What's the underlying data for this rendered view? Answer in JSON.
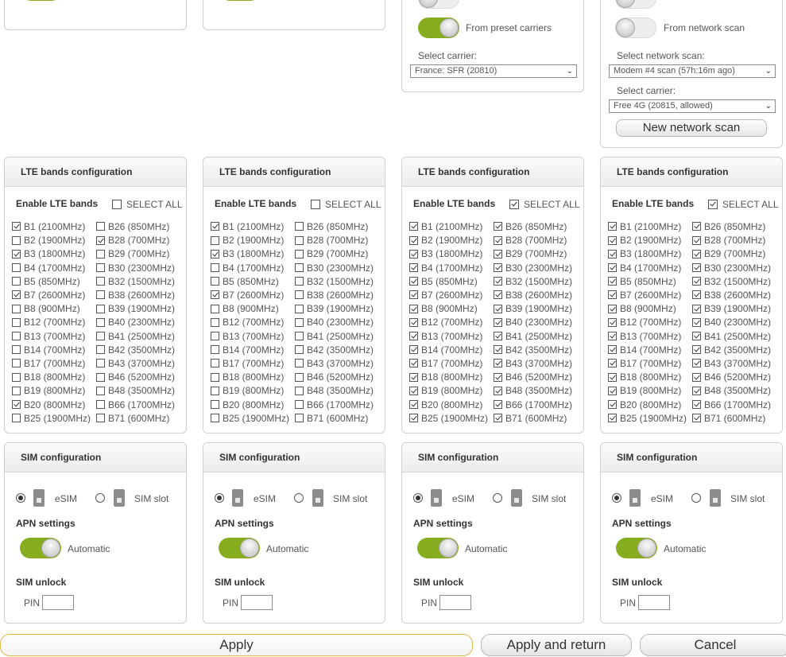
{
  "top": {
    "col3": {
      "from_label": "From preset carriers",
      "select_carrier_label": "Select carrier:",
      "carrier_value": "France: SFR (20810)"
    },
    "col4": {
      "from_label": "From network scan",
      "select_scan_label": "Select network scan:",
      "scan_value": "Modem #4 scan (57h:16m ago)",
      "select_carrier_label": "Select carrier:",
      "carrier_value": "Free 4G (20815, allowed)",
      "new_scan_button": "New network scan"
    }
  },
  "lte": {
    "title": "LTE bands configuration",
    "enable_label": "Enable LTE bands",
    "select_all_label": "SELECT ALL",
    "left_bands": [
      "B1 (2100MHz)",
      "B2 (1900MHz)",
      "B3 (1800MHz)",
      "B4 (1700MHz)",
      "B5 (850MHz)",
      "B7 (2600MHz)",
      "B8 (900MHz)",
      "B12 (700MHz)",
      "B13 (700MHz)",
      "B14 (700MHz)",
      "B17 (700MHz)",
      "B18 (800MHz)",
      "B19 (800MHz)",
      "B20 (800MHz)",
      "B25 (1900MHz)"
    ],
    "right_bands": [
      "B26 (850MHz)",
      "B28 (700MHz)",
      "B29 (700MHz)",
      "B30 (2300MHz)",
      "B32 (1500MHz)",
      "B38 (2600MHz)",
      "B39 (1900MHz)",
      "B40 (2300MHz)",
      "B41 (2500MHz)",
      "B42 (3500MHz)",
      "B43 (3700MHz)",
      "B46 (5200MHz)",
      "B48 (3500MHz)",
      "B66 (1700MHz)",
      "B71 (600MHz)"
    ],
    "modems": [
      {
        "select_all": false,
        "left": [
          true,
          false,
          true,
          false,
          false,
          true,
          false,
          false,
          false,
          false,
          false,
          false,
          false,
          true,
          false
        ],
        "right": [
          false,
          true,
          false,
          false,
          false,
          false,
          false,
          false,
          false,
          false,
          false,
          false,
          false,
          false,
          false
        ]
      },
      {
        "select_all": false,
        "left": [
          true,
          false,
          true,
          false,
          false,
          true,
          false,
          false,
          false,
          false,
          false,
          false,
          false,
          false,
          false
        ],
        "right": [
          false,
          false,
          false,
          false,
          false,
          false,
          false,
          false,
          false,
          false,
          false,
          false,
          false,
          false,
          false
        ]
      },
      {
        "select_all": true,
        "left": [
          true,
          true,
          true,
          true,
          true,
          true,
          true,
          true,
          true,
          true,
          true,
          true,
          true,
          true,
          true
        ],
        "right": [
          true,
          true,
          true,
          true,
          true,
          true,
          true,
          true,
          true,
          true,
          true,
          true,
          true,
          true,
          true
        ]
      },
      {
        "select_all": true,
        "left": [
          true,
          true,
          true,
          true,
          true,
          true,
          true,
          true,
          true,
          true,
          true,
          true,
          true,
          true,
          true
        ],
        "right": [
          true,
          true,
          true,
          true,
          true,
          true,
          true,
          true,
          true,
          true,
          true,
          true,
          true,
          true,
          true
        ]
      }
    ]
  },
  "sim": {
    "title": "SIM configuration",
    "esim_label": "eSIM",
    "slot_label": "SIM slot",
    "apn_label": "APN settings",
    "automatic_label": "Automatic",
    "unlock_label": "SIM unlock",
    "pin_label": "PIN",
    "selected": "esim"
  },
  "footer": {
    "apply": "Apply",
    "apply_return": "Apply and return",
    "cancel": "Cancel"
  },
  "colors": {
    "accent_green": "#86ad1d",
    "apply_border": "#e0b84a"
  }
}
